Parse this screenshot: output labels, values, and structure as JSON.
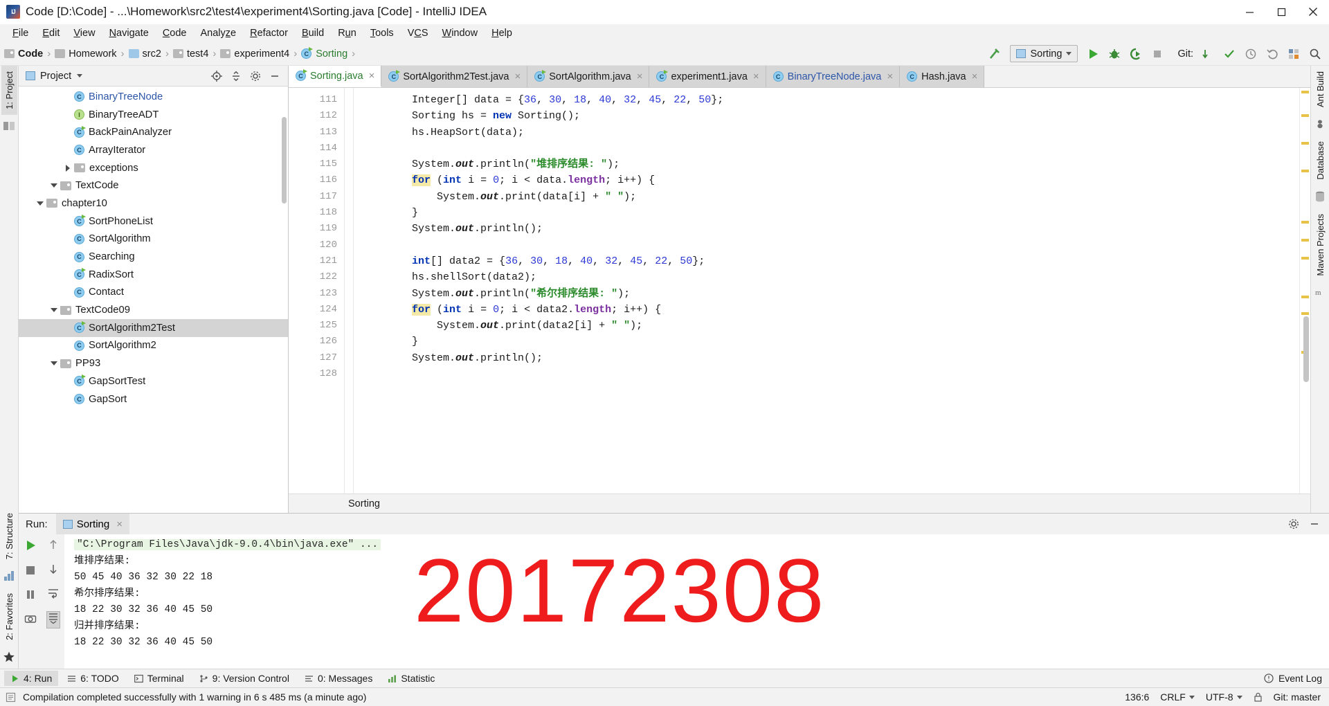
{
  "window": {
    "title": "Code [D:\\Code] - ...\\Homework\\src2\\test4\\experiment4\\Sorting.java [Code] - IntelliJ IDEA",
    "app_icon": "intellij-idea-icon",
    "minimize": "–",
    "maximize": "❐",
    "close": "✕"
  },
  "menubar": {
    "items": [
      {
        "label": "File"
      },
      {
        "label": "Edit"
      },
      {
        "label": "View"
      },
      {
        "label": "Navigate"
      },
      {
        "label": "Code"
      },
      {
        "label": "Analyze"
      },
      {
        "label": "Refactor"
      },
      {
        "label": "Build"
      },
      {
        "label": "Run"
      },
      {
        "label": "Tools"
      },
      {
        "label": "VCS"
      },
      {
        "label": "Window"
      },
      {
        "label": "Help"
      }
    ]
  },
  "navbar": {
    "breadcrumbs": [
      {
        "label": "Code",
        "icon": "module-icon",
        "bold": true
      },
      {
        "label": "Homework",
        "icon": "folder-icon",
        "bold": false
      },
      {
        "label": "src2",
        "icon": "source-folder-icon",
        "bold": false
      },
      {
        "label": "test4",
        "icon": "folder-icon",
        "bold": false
      },
      {
        "label": "experiment4",
        "icon": "folder-icon",
        "bold": false
      },
      {
        "label": "Sorting",
        "icon": "runnable-class-icon",
        "bold": false,
        "green": true
      }
    ],
    "separator": "›",
    "run_config": {
      "label": "Sorting",
      "icon": "run-config-icon"
    },
    "git_label": "Git:",
    "buttons": [
      {
        "name": "build-project-button",
        "icon": "hammer-icon"
      },
      {
        "name": "run-button",
        "icon": "play-icon"
      },
      {
        "name": "debug-button",
        "icon": "bug-icon"
      },
      {
        "name": "run-with-coverage-button",
        "icon": "coverage-icon"
      },
      {
        "name": "stop-button",
        "icon": "stop-icon"
      },
      {
        "name": "update-project-button",
        "icon": "vcs-update-icon"
      },
      {
        "name": "commit-button",
        "icon": "vcs-commit-icon"
      },
      {
        "name": "vcs-history-button",
        "icon": "clock-icon"
      },
      {
        "name": "vcs-revert-button",
        "icon": "undo-icon"
      },
      {
        "name": "settings-button",
        "icon": "gear-grid-icon"
      },
      {
        "name": "search-everywhere-button",
        "icon": "search-icon"
      }
    ]
  },
  "left_strip": {
    "tabs": [
      {
        "label": "1: Project"
      },
      {
        "label": "7: Structure"
      },
      {
        "label": "2: Favorites"
      }
    ],
    "icons": [
      "commander-icon",
      "build-variants-icon",
      "bookmark-star-icon"
    ]
  },
  "right_strip": {
    "tabs": [
      {
        "label": "Ant Build"
      },
      {
        "label": "Database"
      },
      {
        "label": "Maven Projects"
      }
    ],
    "icons": [
      "ant-icon",
      "database-icon",
      "maven-icon"
    ]
  },
  "project_panel": {
    "title": "Project",
    "header_buttons": [
      {
        "name": "scroll-from-source-button",
        "icon": "target-icon"
      },
      {
        "name": "collapse-all-button",
        "icon": "collapse-icon"
      },
      {
        "name": "settings-button",
        "icon": "gear-icon"
      },
      {
        "name": "hide-button",
        "icon": "minimize-icon"
      }
    ],
    "tree": [
      {
        "label": "GapSort",
        "indent": 5,
        "icon": "class-icon",
        "twisty": "",
        "selected": false
      },
      {
        "label": "GapSortTest",
        "indent": 5,
        "icon": "runnable-class-icon",
        "twisty": "",
        "selected": false
      },
      {
        "label": "PP93",
        "indent": 4,
        "icon": "folder-icon",
        "twisty": "down",
        "selected": false
      },
      {
        "label": "SortAlgorithm2",
        "indent": 5,
        "icon": "class-icon",
        "twisty": "",
        "selected": false
      },
      {
        "label": "SortAlgorithm2Test",
        "indent": 5,
        "icon": "runnable-class-icon",
        "twisty": "",
        "selected": true
      },
      {
        "label": "TextCode09",
        "indent": 4,
        "icon": "folder-icon",
        "twisty": "down",
        "selected": false
      },
      {
        "label": "Contact",
        "indent": 5,
        "icon": "class-icon",
        "twisty": "",
        "selected": false
      },
      {
        "label": "RadixSort",
        "indent": 5,
        "icon": "runnable-class-icon",
        "twisty": "",
        "selected": false
      },
      {
        "label": "Searching",
        "indent": 5,
        "icon": "class-icon",
        "twisty": "",
        "selected": false
      },
      {
        "label": "SortAlgorithm",
        "indent": 5,
        "icon": "class-icon",
        "twisty": "",
        "selected": false
      },
      {
        "label": "SortPhoneList",
        "indent": 5,
        "icon": "runnable-class-icon",
        "twisty": "",
        "selected": false
      },
      {
        "label": "chapter10",
        "indent": 3,
        "icon": "folder-icon",
        "twisty": "down",
        "selected": false
      },
      {
        "label": "TextCode",
        "indent": 4,
        "icon": "folder-icon",
        "twisty": "down",
        "selected": false
      },
      {
        "label": "exceptions",
        "indent": 5,
        "icon": "folder-icon",
        "twisty": "right",
        "selected": false
      },
      {
        "label": "ArrayIterator",
        "indent": 5,
        "icon": "class-icon",
        "twisty": "",
        "selected": false
      },
      {
        "label": "BackPainAnalyzer",
        "indent": 5,
        "icon": "runnable-class-icon",
        "twisty": "",
        "selected": false
      },
      {
        "label": "BinaryTreeADT",
        "indent": 5,
        "icon": "interface-icon",
        "twisty": "",
        "selected": false
      },
      {
        "label": "BinaryTreeNode",
        "indent": 5,
        "icon": "class-icon",
        "twisty": "",
        "selected": false,
        "blue": true
      }
    ]
  },
  "editor": {
    "tabs": [
      {
        "label": "Sorting.java",
        "icon": "runnable-class-icon",
        "active": true,
        "color": "green"
      },
      {
        "label": "SortAlgorithm2Test.java",
        "icon": "runnable-class-icon",
        "active": false,
        "color": "dark"
      },
      {
        "label": "SortAlgorithm.java",
        "icon": "runnable-class-icon",
        "active": false,
        "color": "dark"
      },
      {
        "label": "experiment1.java",
        "icon": "runnable-class-icon",
        "active": false,
        "color": "dark"
      },
      {
        "label": "BinaryTreeNode.java",
        "icon": "class-icon",
        "active": false,
        "color": "blue"
      },
      {
        "label": "Hash.java",
        "icon": "class-icon",
        "active": false,
        "color": "dark"
      }
    ],
    "tab_close": "×",
    "line_numbers": [
      111,
      112,
      113,
      114,
      115,
      116,
      117,
      118,
      119,
      120,
      121,
      122,
      123,
      124,
      125,
      126,
      127,
      128
    ],
    "breadcrumb": "Sorting",
    "code_lines": [
      {
        "n": 111,
        "segments": [
          {
            "t": "        Integer[] data = {",
            "c": ""
          },
          {
            "t": "36",
            "c": "num"
          },
          {
            "t": ", ",
            "c": ""
          },
          {
            "t": "30",
            "c": "num"
          },
          {
            "t": ", ",
            "c": ""
          },
          {
            "t": "18",
            "c": "num"
          },
          {
            "t": ", ",
            "c": ""
          },
          {
            "t": "40",
            "c": "num"
          },
          {
            "t": ", ",
            "c": ""
          },
          {
            "t": "32",
            "c": "num"
          },
          {
            "t": ", ",
            "c": ""
          },
          {
            "t": "45",
            "c": "num"
          },
          {
            "t": ", ",
            "c": ""
          },
          {
            "t": "22",
            "c": "num"
          },
          {
            "t": ", ",
            "c": ""
          },
          {
            "t": "50",
            "c": "num"
          },
          {
            "t": "};",
            "c": ""
          }
        ]
      },
      {
        "n": 112,
        "segments": [
          {
            "t": "        Sorting hs = ",
            "c": ""
          },
          {
            "t": "new",
            "c": "kw"
          },
          {
            "t": " Sorting();",
            "c": ""
          }
        ]
      },
      {
        "n": 113,
        "segments": [
          {
            "t": "        hs.HeapSort(data);",
            "c": ""
          }
        ]
      },
      {
        "n": 114,
        "segments": [
          {
            "t": "",
            "c": ""
          }
        ]
      },
      {
        "n": 115,
        "segments": [
          {
            "t": "        System.",
            "c": ""
          },
          {
            "t": "out",
            "c": "stat"
          },
          {
            "t": ".println(",
            "c": ""
          },
          {
            "t": "\"堆排序结果: \"",
            "c": "str"
          },
          {
            "t": ");",
            "c": ""
          }
        ]
      },
      {
        "n": 116,
        "segments": [
          {
            "t": "        ",
            "c": ""
          },
          {
            "t": "for",
            "c": "kwhl"
          },
          {
            "t": " (",
            "c": ""
          },
          {
            "t": "int",
            "c": "kw"
          },
          {
            "t": " i = ",
            "c": ""
          },
          {
            "t": "0",
            "c": "num"
          },
          {
            "t": "; i < data.",
            "c": ""
          },
          {
            "t": "length",
            "c": "fld"
          },
          {
            "t": "; i++) {",
            "c": ""
          }
        ]
      },
      {
        "n": 117,
        "segments": [
          {
            "t": "            System.",
            "c": ""
          },
          {
            "t": "out",
            "c": "stat"
          },
          {
            "t": ".print(data[i] + ",
            "c": ""
          },
          {
            "t": "\" \"",
            "c": "str"
          },
          {
            "t": ");",
            "c": ""
          }
        ]
      },
      {
        "n": 118,
        "segments": [
          {
            "t": "        }",
            "c": ""
          }
        ]
      },
      {
        "n": 119,
        "segments": [
          {
            "t": "        System.",
            "c": ""
          },
          {
            "t": "out",
            "c": "stat"
          },
          {
            "t": ".println();",
            "c": ""
          }
        ]
      },
      {
        "n": 120,
        "segments": [
          {
            "t": "",
            "c": ""
          }
        ]
      },
      {
        "n": 121,
        "segments": [
          {
            "t": "        ",
            "c": ""
          },
          {
            "t": "int",
            "c": "kw"
          },
          {
            "t": "[] data2 = {",
            "c": ""
          },
          {
            "t": "36",
            "c": "num"
          },
          {
            "t": ", ",
            "c": ""
          },
          {
            "t": "30",
            "c": "num"
          },
          {
            "t": ", ",
            "c": ""
          },
          {
            "t": "18",
            "c": "num"
          },
          {
            "t": ", ",
            "c": ""
          },
          {
            "t": "40",
            "c": "num"
          },
          {
            "t": ", ",
            "c": ""
          },
          {
            "t": "32",
            "c": "num"
          },
          {
            "t": ", ",
            "c": ""
          },
          {
            "t": "45",
            "c": "num"
          },
          {
            "t": ", ",
            "c": ""
          },
          {
            "t": "22",
            "c": "num"
          },
          {
            "t": ", ",
            "c": ""
          },
          {
            "t": "50",
            "c": "num"
          },
          {
            "t": "};",
            "c": ""
          }
        ]
      },
      {
        "n": 122,
        "segments": [
          {
            "t": "        hs.shellSort(data2);",
            "c": ""
          }
        ]
      },
      {
        "n": 123,
        "segments": [
          {
            "t": "        System.",
            "c": ""
          },
          {
            "t": "out",
            "c": "stat"
          },
          {
            "t": ".println(",
            "c": ""
          },
          {
            "t": "\"希尔排序结果: \"",
            "c": "str"
          },
          {
            "t": ");",
            "c": ""
          }
        ]
      },
      {
        "n": 124,
        "segments": [
          {
            "t": "        ",
            "c": ""
          },
          {
            "t": "for",
            "c": "kwhl"
          },
          {
            "t": " (",
            "c": ""
          },
          {
            "t": "int",
            "c": "kw"
          },
          {
            "t": " i = ",
            "c": ""
          },
          {
            "t": "0",
            "c": "num"
          },
          {
            "t": "; i < data2.",
            "c": ""
          },
          {
            "t": "length",
            "c": "fld"
          },
          {
            "t": "; i++) {",
            "c": ""
          }
        ]
      },
      {
        "n": 125,
        "segments": [
          {
            "t": "            System.",
            "c": ""
          },
          {
            "t": "out",
            "c": "stat"
          },
          {
            "t": ".print(data2[i] + ",
            "c": ""
          },
          {
            "t": "\" \"",
            "c": "str"
          },
          {
            "t": ");",
            "c": ""
          }
        ]
      },
      {
        "n": 126,
        "segments": [
          {
            "t": "        }",
            "c": ""
          }
        ]
      },
      {
        "n": 127,
        "segments": [
          {
            "t": "        System.",
            "c": ""
          },
          {
            "t": "out",
            "c": "stat"
          },
          {
            "t": ".println();",
            "c": ""
          }
        ]
      },
      {
        "n": 128,
        "segments": [
          {
            "t": "",
            "c": ""
          }
        ]
      }
    ]
  },
  "run_panel": {
    "label": "Run:",
    "tab": "Sorting",
    "tab_close": "×",
    "header_buttons": [
      {
        "name": "settings-button",
        "icon": "gear-icon"
      },
      {
        "name": "hide-button",
        "icon": "minimize-icon"
      }
    ],
    "toolbar_buttons": [
      {
        "name": "rerun-button",
        "icon": "play-icon"
      },
      {
        "name": "stop-button",
        "icon": "stop-icon"
      },
      {
        "name": "pause-button",
        "icon": "pause-icon"
      },
      {
        "name": "camera-button",
        "icon": "camera-icon"
      },
      {
        "name": "prev-occurrence-button",
        "icon": "arrow-up-icon"
      },
      {
        "name": "next-occurrence-button",
        "icon": "arrow-down-icon"
      },
      {
        "name": "soft-wrap-button",
        "icon": "wrap-icon"
      },
      {
        "name": "scroll-to-end-button",
        "icon": "scroll-end-icon"
      }
    ],
    "console_lines": [
      {
        "text": "\"C:\\Program Files\\Java\\jdk-9.0.4\\bin\\java.exe\" ...",
        "style": "cmd"
      },
      {
        "text": "堆排序结果: ",
        "style": "plain"
      },
      {
        "text": "50 45 40 36 32 30 22 18 ",
        "style": "plain"
      },
      {
        "text": "希尔排序结果: ",
        "style": "plain"
      },
      {
        "text": "18 22 30 32 36 40 45 50 ",
        "style": "plain"
      },
      {
        "text": "归并排序结果: ",
        "style": "plain"
      },
      {
        "text": "18 22 30 32 36 40 45 50 ",
        "style": "plain"
      }
    ],
    "watermark": "20172308"
  },
  "bottom_bar": {
    "items": [
      {
        "label": "4: Run",
        "icon": "play-icon",
        "selected": true
      },
      {
        "label": "6: TODO",
        "icon": "todo-icon",
        "selected": false
      },
      {
        "label": "Terminal",
        "icon": "terminal-icon",
        "selected": false
      },
      {
        "label": "9: Version Control",
        "icon": "branch-icon",
        "selected": false
      },
      {
        "label": "0: Messages",
        "icon": "messages-icon",
        "selected": false
      },
      {
        "label": "Statistic",
        "icon": "statistic-icon",
        "selected": false
      }
    ],
    "event_log": "Event Log",
    "event_log_icon": "event-log-icon"
  },
  "status_bar": {
    "message": "Compilation completed successfully with 1 warning in 6 s 485 ms (a minute ago)",
    "icon": "info-icon",
    "caret": "136:6",
    "line_sep": "CRLF",
    "encoding": "UTF-8",
    "branch": "Git: master",
    "lock_icon": "lock-icon"
  },
  "colors": {
    "accent_green": "#2a7d2e",
    "link_blue": "#2d56a8",
    "watermark_red": "#ee1c1c",
    "selection_gray": "#d4d4d4"
  }
}
